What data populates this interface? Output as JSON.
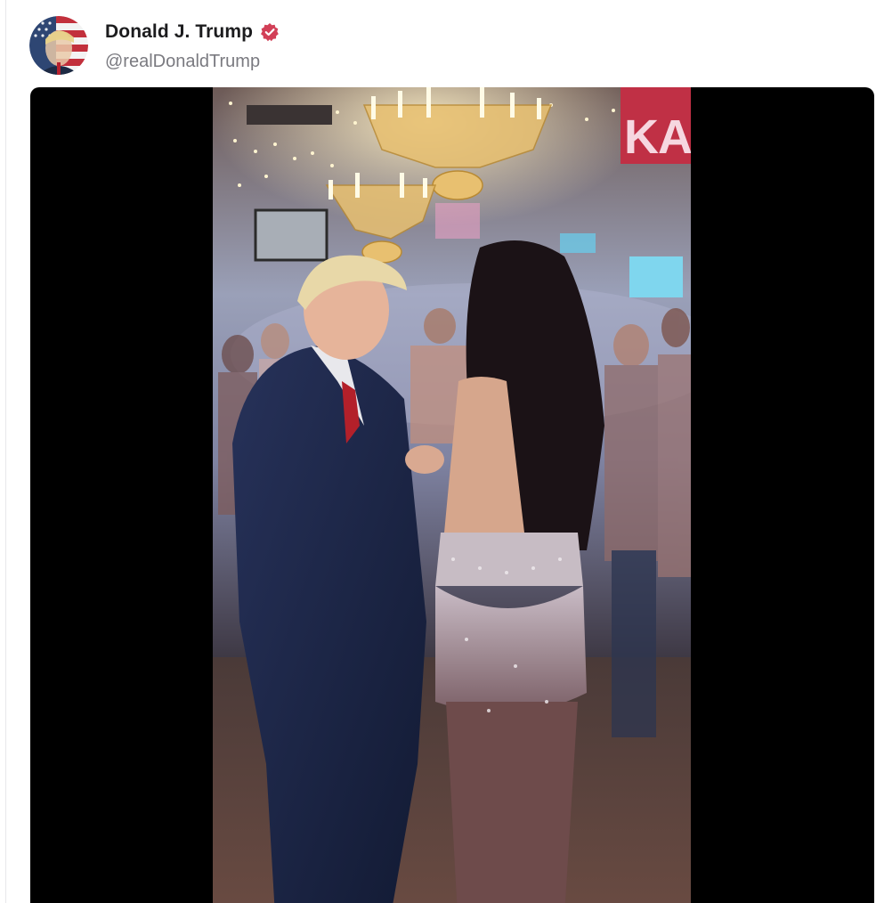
{
  "post": {
    "author": {
      "display_name": "Donald J. Trump",
      "handle": "@realDonaldTrump",
      "verified": true,
      "verified_badge_color": "#d23f57",
      "avatar_icon": "american-flag-portrait-avatar"
    },
    "media": {
      "type": "video",
      "background_color": "#000000",
      "sign_text": "KAL"
    }
  }
}
